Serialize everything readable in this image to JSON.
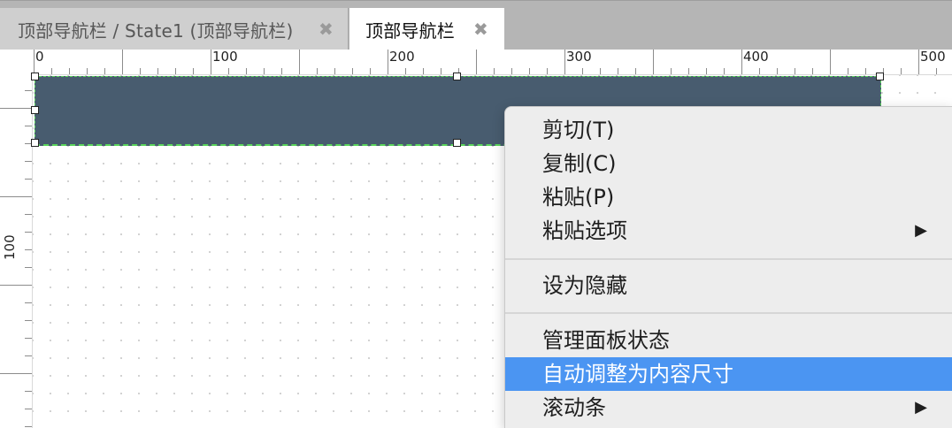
{
  "tabs": [
    {
      "label": "顶部导航栏 / State1 (顶部导航栏)",
      "close": "✖",
      "active": false
    },
    {
      "label": "顶部导航栏",
      "close": "✖",
      "active": true
    }
  ],
  "ruler": {
    "top_labels": [
      "0",
      "100",
      "200",
      "300",
      "400",
      "500"
    ],
    "left_labels": [
      "100"
    ]
  },
  "canvas": {
    "shape_color": "#485c6f",
    "selection_color": "#5ad55a"
  },
  "context_menu": {
    "items": [
      {
        "label": "剪切(T)"
      },
      {
        "label": "复制(C)"
      },
      {
        "label": "粘贴(P)"
      },
      {
        "label": "粘贴选项",
        "submenu_arrow": "▶"
      },
      {
        "label": "设为隐藏"
      },
      {
        "label": "管理面板状态"
      },
      {
        "label": "自动调整为内容尺寸",
        "highlighted": true
      },
      {
        "label": "滚动条",
        "submenu_arrow": "▶"
      }
    ],
    "highlight_color": "#4b95f2"
  }
}
